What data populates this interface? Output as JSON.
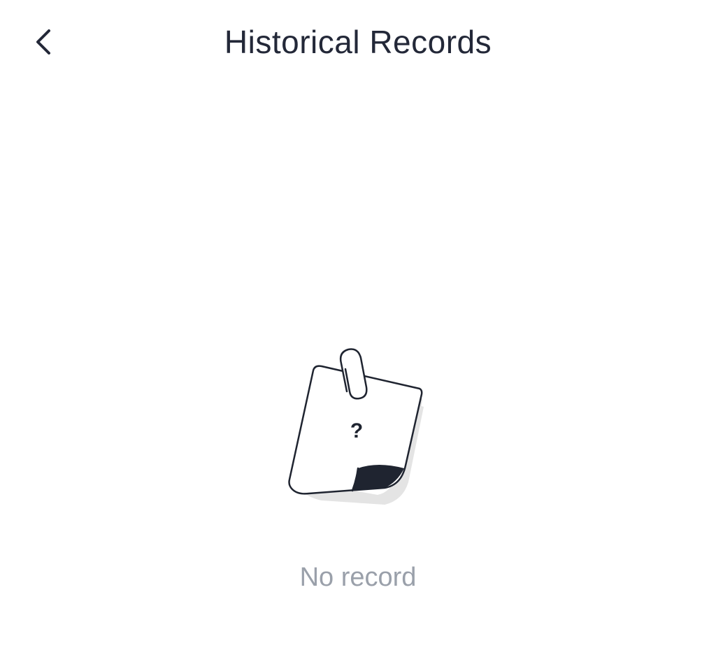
{
  "header": {
    "title": "Historical Records",
    "back_icon": "chevron-left-icon"
  },
  "empty_state": {
    "icon": "note-question-icon",
    "question_mark": "?",
    "message": "No record"
  },
  "colors": {
    "title": "#232838",
    "message": "#9aa0aa",
    "illustration_stroke": "#1f2430",
    "illustration_shadow": "#e1e1e1"
  }
}
